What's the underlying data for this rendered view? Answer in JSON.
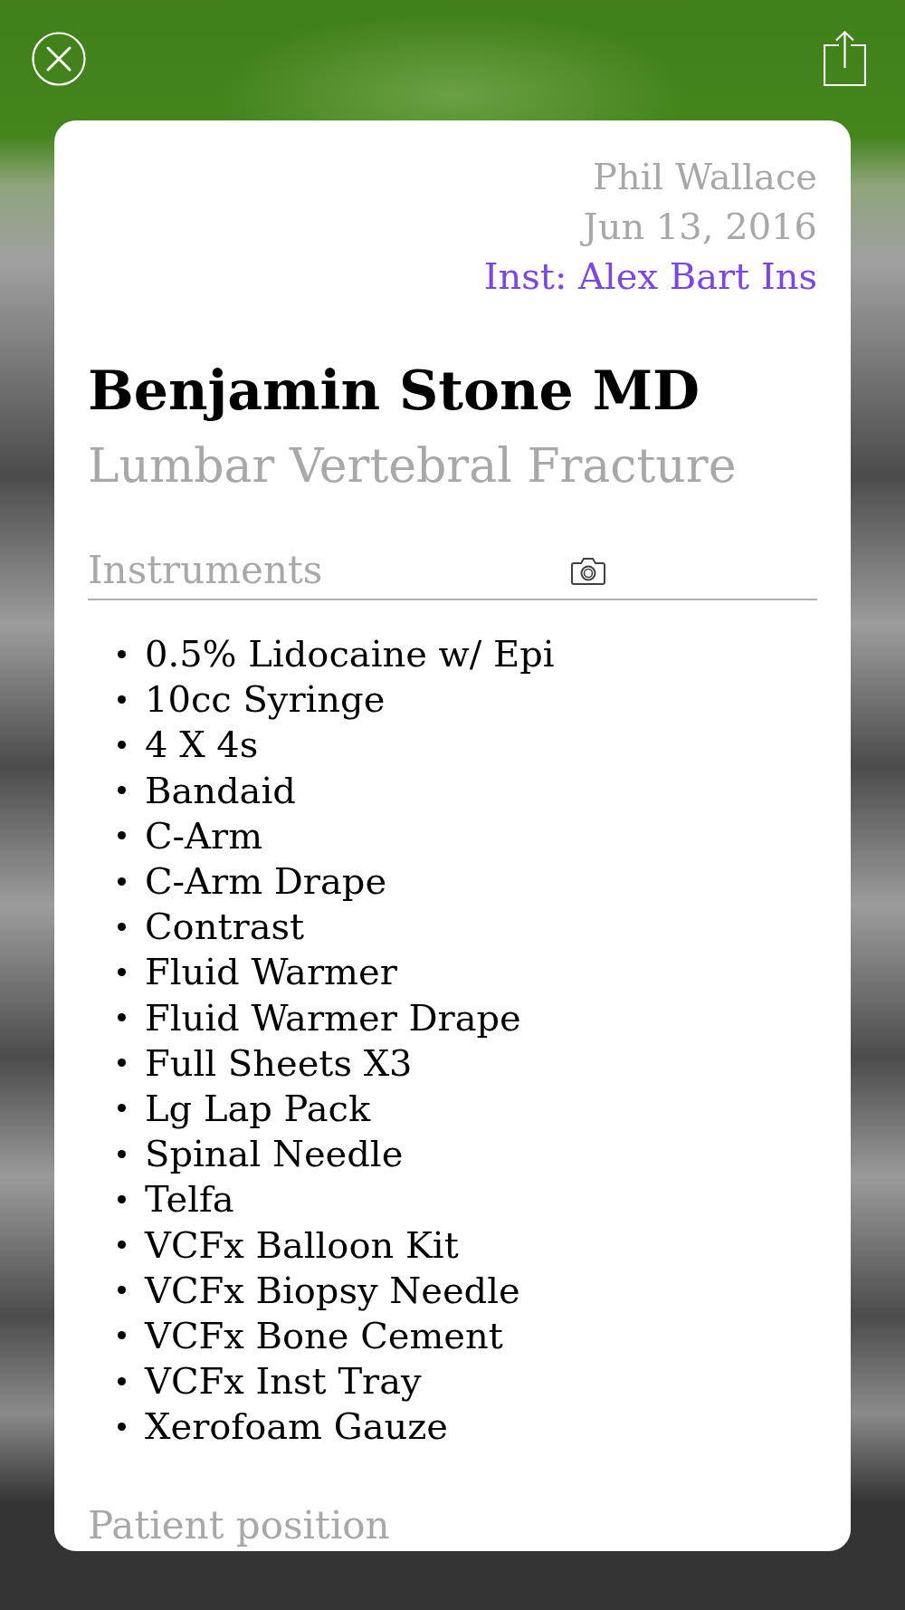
{
  "header": {
    "author": "Phil Wallace",
    "date": "Jun 13, 2016",
    "institution": "Inst: Alex Bart Ins"
  },
  "title": "Benjamin Stone MD",
  "subtitle": "Lumbar Vertebral Fracture",
  "instruments": {
    "heading": "Instruments",
    "items": [
      "0.5% Lidocaine w/ Epi",
      "10cc Syringe",
      "4 X 4s",
      "Bandaid",
      "C-Arm",
      "C-Arm Drape",
      "Contrast",
      "Fluid Warmer",
      "Fluid Warmer Drape",
      "Full Sheets X3",
      "Lg Lap Pack",
      "Spinal Needle",
      "Telfa",
      "VCFx Balloon Kit",
      "VCFx Biopsy Needle",
      "VCFx Bone Cement",
      "VCFx Inst Tray",
      "Xerofoam Gauze"
    ]
  },
  "patient_position": {
    "heading": "Patient position"
  }
}
